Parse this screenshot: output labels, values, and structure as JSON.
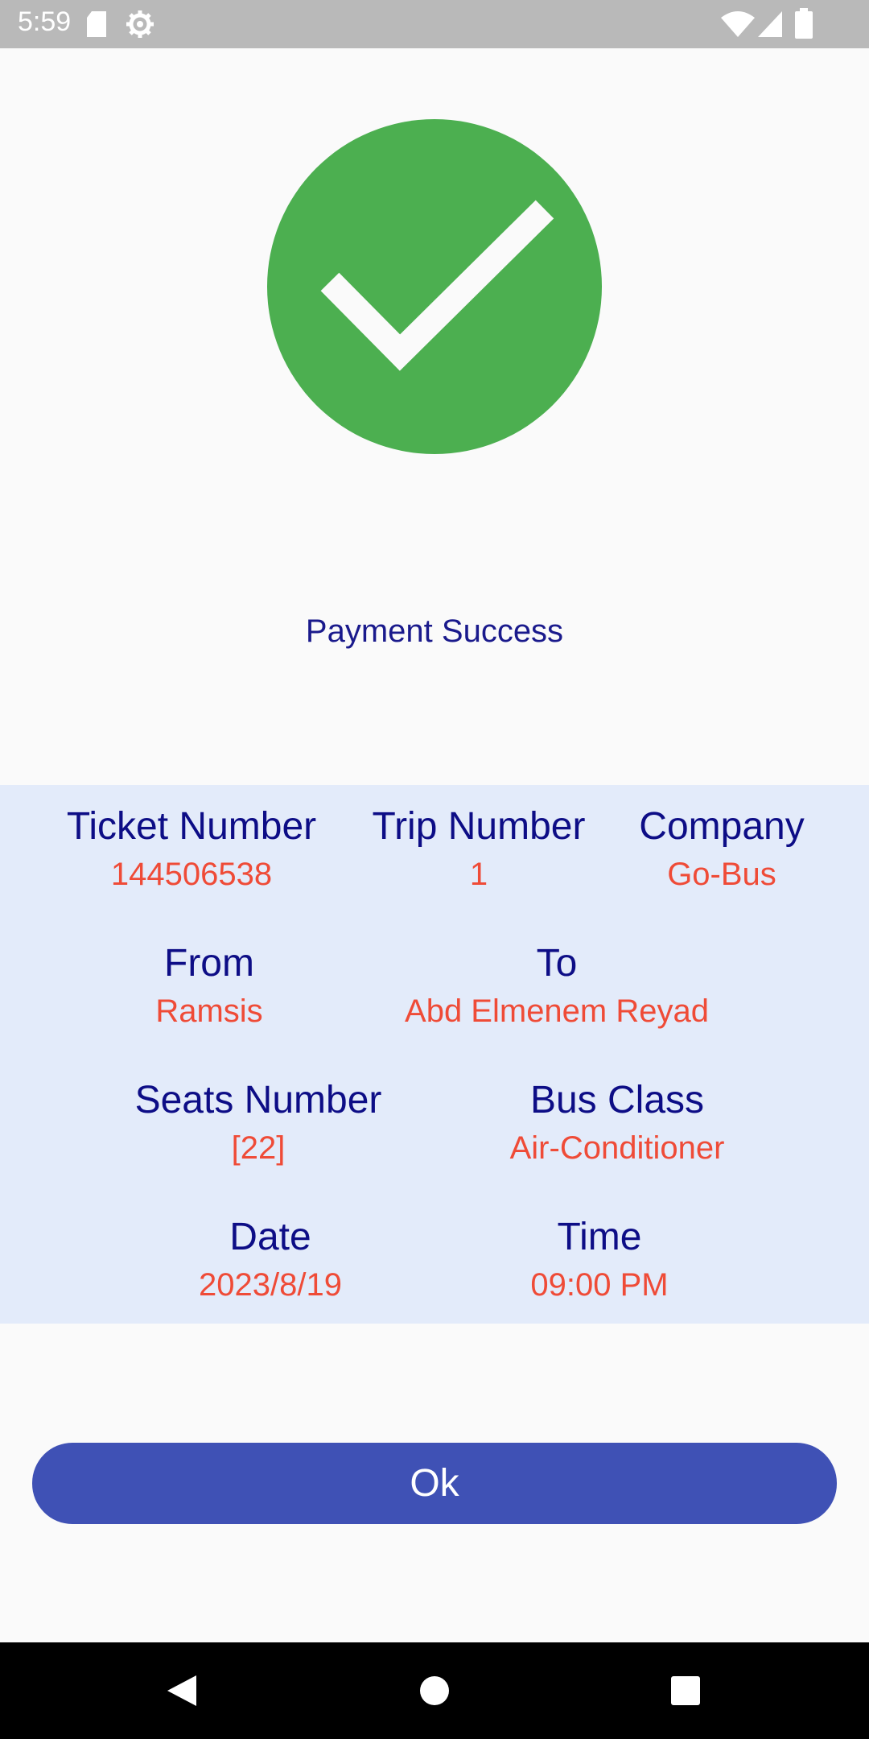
{
  "status_bar": {
    "time": "5:59",
    "icons": [
      "sd-card-icon",
      "settings-gear-icon",
      "wifi-icon",
      "signal-icon",
      "battery-icon"
    ]
  },
  "success": {
    "icon": "check-circle-icon",
    "title": "Payment Success",
    "color": "#4caf50"
  },
  "details": {
    "ticket_number": {
      "label": "Ticket Number",
      "value": "144506538"
    },
    "trip_number": {
      "label": "Trip Number",
      "value": "1"
    },
    "company": {
      "label": "Company",
      "value": "Go-Bus"
    },
    "from": {
      "label": "From",
      "value": "Ramsis"
    },
    "to": {
      "label": "To",
      "value": "Abd Elmenem Reyad"
    },
    "seats_number": {
      "label": "Seats Number",
      "value": "[22]"
    },
    "bus_class": {
      "label": "Bus Class",
      "value": "Air-Conditioner"
    },
    "date": {
      "label": "Date",
      "value": "2023/8/19"
    },
    "time": {
      "label": "Time",
      "value": "09:00 PM"
    }
  },
  "ok_button": {
    "label": "Ok",
    "color": "#3f51b5"
  },
  "nav_bar": {
    "icons": [
      "back-icon",
      "home-icon",
      "recents-icon"
    ]
  }
}
